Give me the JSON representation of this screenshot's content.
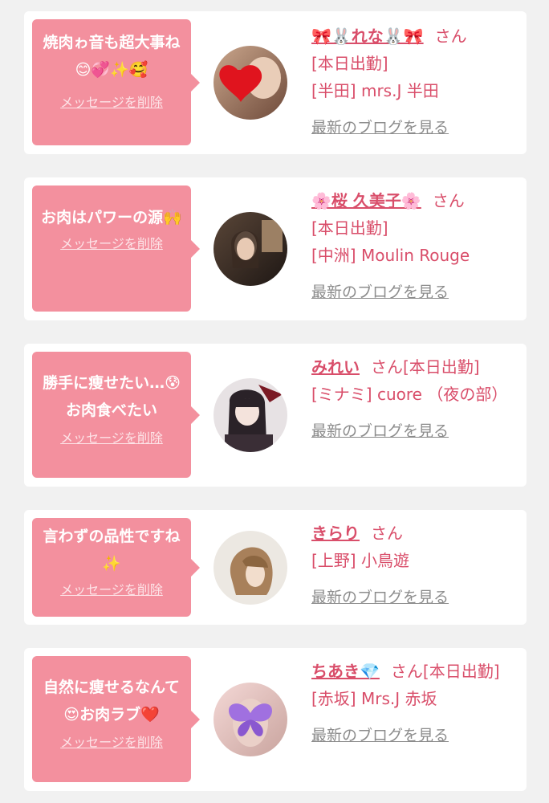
{
  "cards": [
    {
      "message": "焼肉ゎ音も超大事ね😊💞✨🥰",
      "delete_label": "メッセージを削除",
      "name": "🎀🐰れな🐰🎀",
      "honorific": "さん",
      "status": "[本日出勤]",
      "shop": "[半田] mrs.J 半田",
      "blog_label": "最新のブログを見る",
      "avatar_icon": "heart-sticker-photo"
    },
    {
      "message": "お肉はパワーの源🙌",
      "delete_label": "メッセージを削除",
      "name": "🌸桜 久美子🌸",
      "honorific": "さん",
      "status": "[本日出勤]",
      "shop": "[中洲] Moulin Rouge",
      "blog_label": "最新のブログを見る",
      "avatar_icon": "portrait-photo"
    },
    {
      "message": "勝手に痩せたい…😰お肉食べたい",
      "delete_label": "メッセージを削除",
      "name": "みれい",
      "honorific": "さん",
      "status": "[本日出勤]",
      "shop": "[ミナミ] cuore （夜の部）",
      "blog_label": "最新のブログを見る",
      "avatar_icon": "anime-character-photo"
    },
    {
      "message": "言わずの品性ですね✨",
      "delete_label": "メッセージを削除",
      "name": "きらり",
      "honorific": "さん",
      "status": "",
      "shop": "[上野] 小鳥遊",
      "blog_label": "最新のブログを見る",
      "avatar_icon": "hair-photo"
    },
    {
      "message": "自然に痩せるなんて😍お肉ラブ❤️",
      "delete_label": "メッセージを削除",
      "name": "ちあき💎",
      "honorific": "さん",
      "status": "[本日出勤]",
      "shop": "[赤坂] Mrs.J 赤坂",
      "blog_label": "最新のブログを見る",
      "avatar_icon": "butterfly-sticker-photo"
    }
  ],
  "colors": {
    "bubble": "#f3909e",
    "accent_text": "#d94e6a",
    "link_gray": "#8c8c8c",
    "page_bg": "#f1f1f1"
  }
}
